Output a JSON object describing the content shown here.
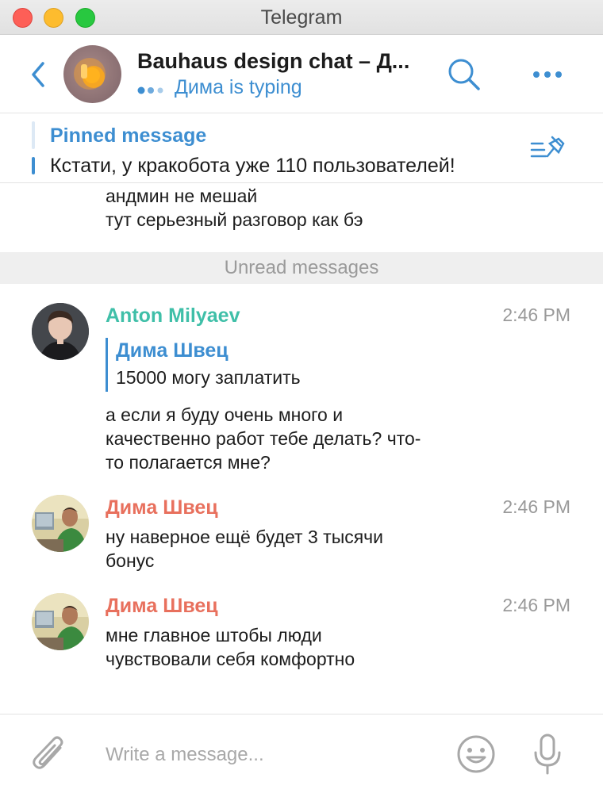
{
  "window": {
    "app_title": "Telegram"
  },
  "header": {
    "chat_title": "Bauhaus design chat – Д...",
    "typing_status": "Дима is typing"
  },
  "pinned": {
    "title": "Pinned message",
    "text": "Кстати, у кракобота уже 110 пользователей!"
  },
  "previous_message": {
    "lines": [
      "андмин не мешай",
      "тут серьезный разговор как бэ"
    ]
  },
  "unread_divider": "Unread messages",
  "messages": [
    {
      "sender": "Anton Milyaev",
      "time": "2:46 PM",
      "reply": {
        "author": "Дима Швец",
        "text": "15000 могу заплатить"
      },
      "lines": [
        "а если я буду очень много и",
        "качественно работ тебе делать? что-",
        "то полагается мне?"
      ]
    },
    {
      "sender": "Дима Швец",
      "time": "2:46 PM",
      "lines": [
        "ну наверное ещё будет 3 тысячи",
        "бонус"
      ]
    },
    {
      "sender": "Дима Швец",
      "time": "2:46 PM",
      "lines": [
        "мне главное штобы люди",
        "чувствовали себя комфортно"
      ]
    }
  ],
  "composer": {
    "placeholder": "Write a message..."
  },
  "colors": {
    "accent": "#3d8ed1",
    "sender_anton": "#3fbfa8",
    "sender_dima": "#e8705d",
    "divider_bg": "#efefef"
  },
  "icons": {
    "back": "chevron-left-icon",
    "search": "search-icon",
    "more": "more-dots-icon",
    "pinned_list": "pinned-list-icon",
    "attach": "paperclip-icon",
    "emoji": "smiley-icon",
    "mic": "microphone-icon"
  }
}
